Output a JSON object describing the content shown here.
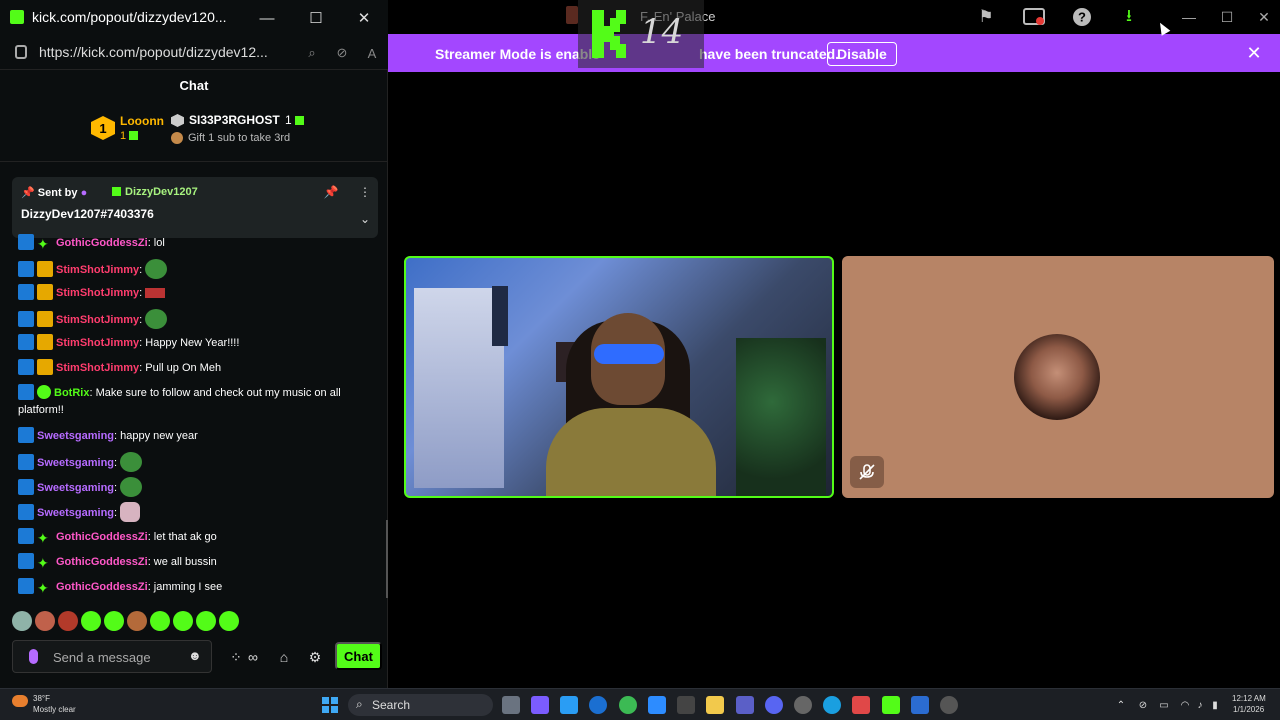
{
  "popout": {
    "window_title": "kick.com/popout/dizzydev120...",
    "url": "https://kick.com/popout/dizzydev12...",
    "minimize": "—",
    "maximize": "☐",
    "close": "✕"
  },
  "chat": {
    "header": "Chat",
    "leaderboard": {
      "first": {
        "rank": "1",
        "name": "Looonn",
        "count": "1"
      },
      "second": {
        "name": "SI33P3RGHOST",
        "count": "1"
      },
      "third_text": "Gift 1 sub to take 3rd"
    },
    "pinned": {
      "label": "Sent by",
      "user": "DizzyDev1207",
      "message": "DizzyDev1207#7403376"
    },
    "messages": [
      {
        "user": "GothicGoddessZi",
        "text": ": lol"
      },
      {
        "user": "StimShotJimmy",
        "text": ":"
      },
      {
        "user": "StimShotJimmy",
        "text": ":"
      },
      {
        "user": "StimShotJimmy",
        "text": ":"
      },
      {
        "user": "StimShotJimmy",
        "text": ": Happy New Year!!!!"
      },
      {
        "user": "StimShotJimmy",
        "text": ": Pull up On Meh"
      },
      {
        "user": "BotRix",
        "text": ": Make sure to follow and check out my music on all platform!!"
      },
      {
        "user": "Sweetsgaming",
        "text": ": happy new year"
      },
      {
        "user": "Sweetsgaming",
        "text": ":"
      },
      {
        "user": "Sweetsgaming",
        "text": ":"
      },
      {
        "user": "Sweetsgaming",
        "text": ":"
      },
      {
        "user": "GothicGoddessZi",
        "text": ": let that ak go"
      },
      {
        "user": "GothicGoddessZi",
        "text": ": we all bussin"
      },
      {
        "user": "GothicGoddessZi",
        "text": ": jamming I see"
      }
    ],
    "input_placeholder": "Send a message",
    "send_label": "Chat"
  },
  "app": {
    "title": "F. En' Palace",
    "overlay_number": "14",
    "streamer_notice": "Streamer Mode is enabled. Usernames have been truncated.",
    "streamer_notice_visible": "Streamer Mode is enable",
    "streamer_notice_tail": "have been truncated.",
    "disable_label": "Disable",
    "close_label": "✕"
  },
  "taskbar": {
    "weather_temp": "38°F",
    "weather_desc": "Mostly clear",
    "search_label": "Search",
    "time": "12:12 AM",
    "date": "1/1/2026"
  },
  "colors": {
    "kick_green": "#53fc18",
    "streamer_bar": "#a347ff",
    "avatar_tile": "#b78466"
  }
}
